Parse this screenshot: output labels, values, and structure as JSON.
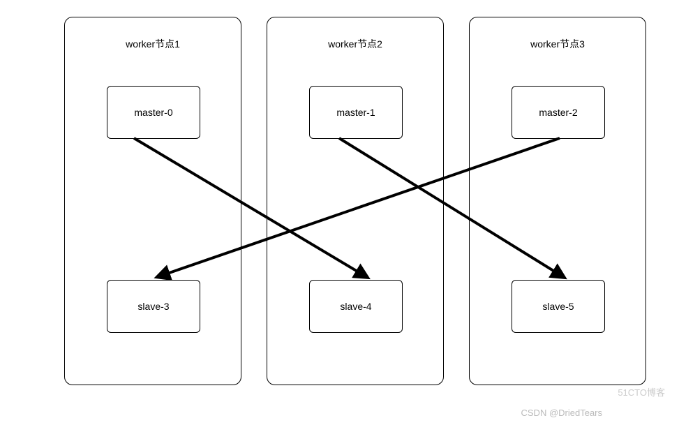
{
  "workers": [
    {
      "title": "worker节点1",
      "master": "master-0",
      "slave": "slave-3"
    },
    {
      "title": "worker节点2",
      "master": "master-1",
      "slave": "slave-4"
    },
    {
      "title": "worker节点3",
      "master": "master-2",
      "slave": "slave-5"
    }
  ],
  "relations": [
    {
      "from_master": "master-0",
      "to_slave": "slave-4"
    },
    {
      "from_master": "master-1",
      "to_slave": "slave-5"
    },
    {
      "from_master": "master-2",
      "to_slave": "slave-3"
    }
  ],
  "watermarks": {
    "w1": "51CTO博客",
    "w2": "CSDN @DriedTears"
  }
}
